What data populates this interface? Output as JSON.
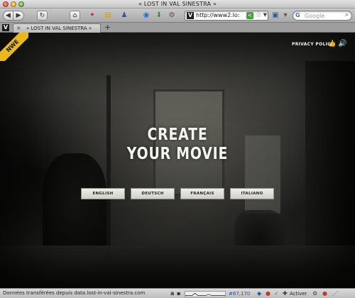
{
  "window": {
    "title": "« LOST IN VAL SINESTRA »"
  },
  "toolbar": {
    "url": "http://www2.lo:",
    "search_placeholder": "Google",
    "search_engine_letter": "G",
    "icons": [
      "back-icon",
      "forward-icon",
      "reload-icon",
      "home-icon",
      "bookmark-icon",
      "note-icon",
      "user-icon",
      "download-icon",
      "globe-icon",
      "favicon",
      "share-icon",
      "star-icon"
    ]
  },
  "tabs": [
    {
      "label": "« LOST IN VAL SINESTRA »",
      "favicon": "V"
    }
  ],
  "page": {
    "badge": "NWE",
    "privacy_label": "PRIVACY POLICY",
    "headline_line1": "CREATE",
    "headline_line2": "YOUR MOVIE",
    "languages": [
      "ENGLISH",
      "DEUTSCH",
      "FRANÇAIS",
      "ITALIANO"
    ]
  },
  "status": {
    "text": "Données transférées depuis data.lost-in-val-sinestra.com",
    "counter": "#67,170",
    "activate": "Activer",
    "status_letter": "a"
  }
}
